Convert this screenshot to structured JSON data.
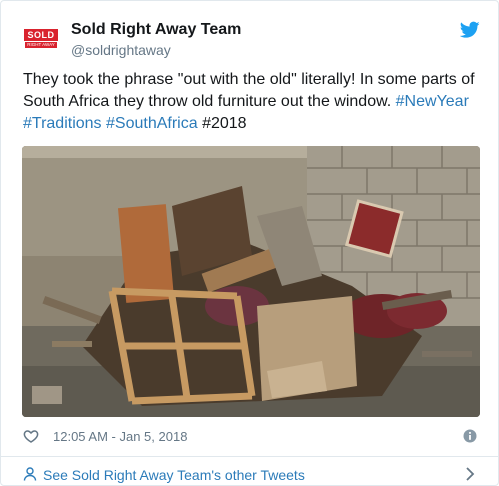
{
  "account": {
    "display_name": "Sold Right Away Team",
    "handle": "@soldrightaway",
    "avatar_logo_top": "SOLD",
    "avatar_logo_bottom": "RIGHT AWAY"
  },
  "tweet": {
    "text_parts": [
      {
        "text": "They took the phrase \"out with the old\" literally! In some parts of South Africa they throw old furniture out the window. ",
        "is_link": false
      },
      {
        "text": "#NewYear",
        "is_link": true
      },
      {
        "text": " ",
        "is_link": false
      },
      {
        "text": "#Traditions",
        "is_link": true
      },
      {
        "text": " ",
        "is_link": false
      },
      {
        "text": "#SouthAfrica",
        "is_link": true
      },
      {
        "text": " #2018",
        "is_link": false
      }
    ],
    "timestamp": "12:05 AM - Jan 5, 2018"
  },
  "footer": {
    "link_label": "See Sold Right Away Team's other Tweets"
  },
  "icons": {
    "brand": "twitter-bird-icon",
    "like": "heart-icon",
    "info": "info-icon",
    "profile": "person-icon",
    "navigate": "chevron-right-icon"
  },
  "colors": {
    "link": "#2b7bb9",
    "twitter_blue": "#1da1f2",
    "muted": "#657786",
    "brand_red": "#d9232e"
  }
}
